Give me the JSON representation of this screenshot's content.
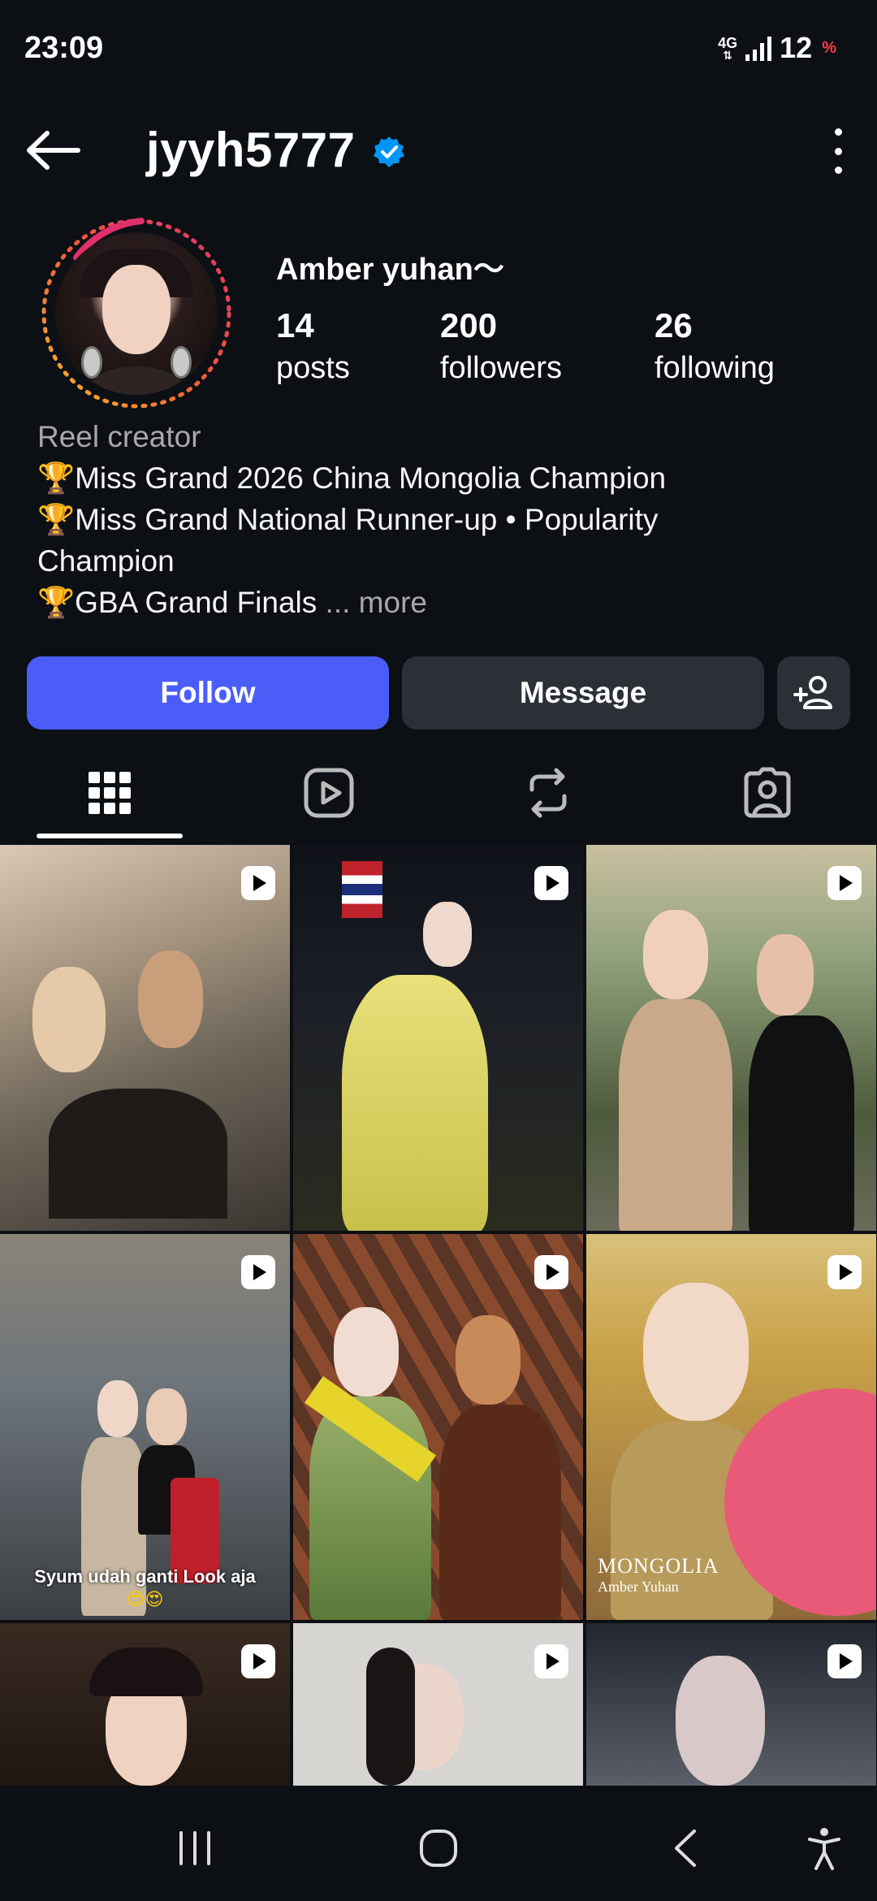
{
  "status_bar": {
    "time": "23:09",
    "network": "4G",
    "battery": "12",
    "battery_unit": "%"
  },
  "header": {
    "username": "jyyh5777",
    "verified": true,
    "icons": [
      "back-arrow-icon",
      "verified-badge-icon",
      "more-vertical-icon"
    ]
  },
  "profile": {
    "display_name": "Amber yuhan～",
    "stats": {
      "posts": {
        "count": "14",
        "label": "posts"
      },
      "followers": {
        "count": "200",
        "label": "followers"
      },
      "following": {
        "count": "26",
        "label": "following"
      }
    },
    "category": "Reel creator",
    "bio_lines": [
      "Miss Grand 2026 China Mongolia Champion",
      "Miss Grand National Runner-up • Popularity",
      "Champion",
      "GBA Grand Finals"
    ],
    "bio_trophy": "🏆",
    "more_label": "... more"
  },
  "actions": {
    "follow_label": "Follow",
    "message_label": "Message",
    "add_user_icon": "add-person-icon"
  },
  "tabs": [
    {
      "name": "posts-grid",
      "icon": "grid-icon",
      "active": true
    },
    {
      "name": "reels",
      "icon": "reels-play-icon",
      "active": false
    },
    {
      "name": "reposts",
      "icon": "repost-icon",
      "active": false
    },
    {
      "name": "tagged",
      "icon": "tagged-person-icon",
      "active": false
    }
  ],
  "grid": {
    "cells": [
      {
        "type": "reel",
        "colors": [
          "#d8c8b4",
          "#6b6458",
          "#3a3530"
        ]
      },
      {
        "type": "reel",
        "colors": [
          "#0f1218",
          "#d9d26a",
          "#1b1e26"
        ]
      },
      {
        "type": "reel",
        "colors": [
          "#8fa07a",
          "#c9a98a",
          "#4d5a3c"
        ]
      },
      {
        "type": "reel",
        "colors": [
          "#6d747a",
          "#c7b7a2",
          "#3b3f43"
        ],
        "caption": "Syum udah ganti Look aja",
        "caption2": "😍😍"
      },
      {
        "type": "reel",
        "colors": [
          "#8a4a2e",
          "#7a9a4a",
          "#5a3424"
        ]
      },
      {
        "type": "reel",
        "colors": [
          "#c9a24a",
          "#e85a78",
          "#8e6a3a"
        ],
        "overlay_text": "MONGOLIA",
        "overlay_subtext": "Amber Yuhan"
      },
      {
        "type": "reel",
        "colors": [
          "#3a2a22",
          "#c98a5a",
          "#1e1612"
        ]
      },
      {
        "type": "reel",
        "colors": [
          "#d7d5d2",
          "#a9a5a0",
          "#2a2422"
        ]
      },
      {
        "type": "reel",
        "colors": [
          "#22262e",
          "#d8c8c8",
          "#5a5e68"
        ]
      }
    ]
  },
  "system_nav": {
    "icons": [
      "recent-apps-icon",
      "home-icon",
      "back-icon",
      "accessibility-icon"
    ]
  }
}
